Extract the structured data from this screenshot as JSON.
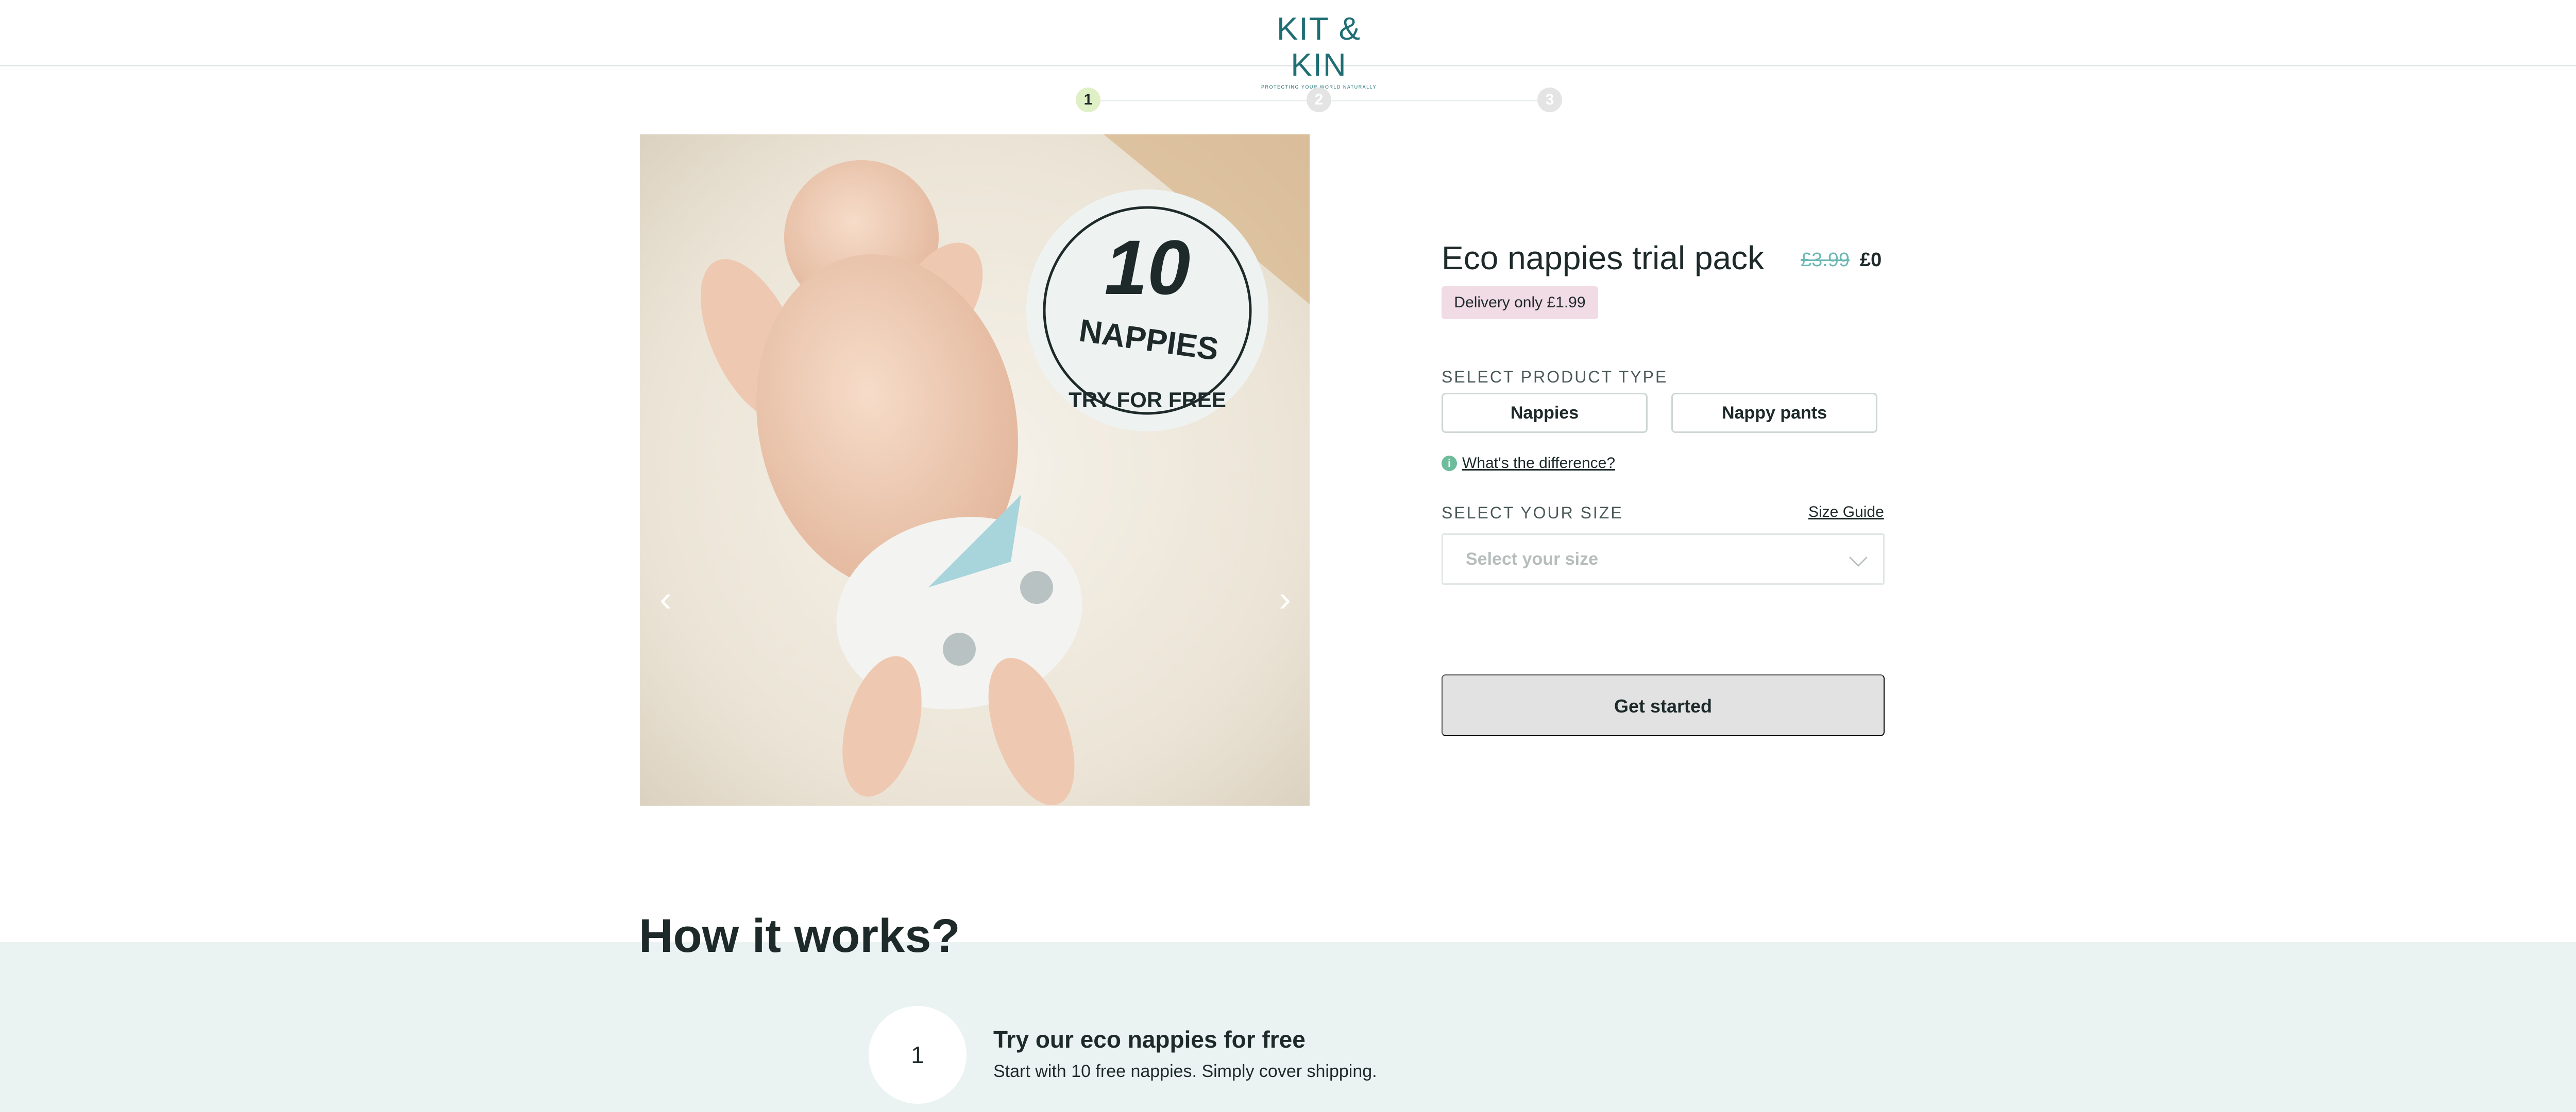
{
  "header": {
    "logo_text": "KIT & KIN",
    "logo_tagline": "PROTECTING YOUR WORLD NATURALLY"
  },
  "stepper": {
    "steps": [
      "1",
      "2",
      "3"
    ],
    "active_step": 1
  },
  "hero": {
    "badge_number": "10",
    "badge_word": "NAPPIES",
    "badge_sub": "TRY FOR FREE",
    "prev_icon": "chevron-left-icon",
    "next_icon": "chevron-right-icon"
  },
  "product": {
    "title": "Eco nappies trial pack",
    "price_old": "£3.99",
    "price_new": "£0",
    "delivery_badge": "Delivery only £1.99",
    "type_label": "SELECT PRODUCT TYPE",
    "type_options": [
      "Nappies",
      "Nappy pants"
    ],
    "difference_link": "What's the difference?",
    "size_label": "SELECT YOUR SIZE",
    "size_guide": "Size Guide",
    "size_placeholder": "Select your size",
    "cta_label": "Get started"
  },
  "how": {
    "title": "How it works?",
    "steps": [
      {
        "number": "1",
        "title": "Try our eco nappies for free",
        "description": "Start with 10 free nappies. Simply cover shipping."
      }
    ]
  },
  "colors": {
    "brand": "#1f6e73",
    "accent_teal": "#6bb8b4",
    "step_active": "#dff0c6",
    "badge_pink": "#f1dbe4",
    "band": "#eaf3f2",
    "cta_disabled": "#e2e2e2"
  }
}
